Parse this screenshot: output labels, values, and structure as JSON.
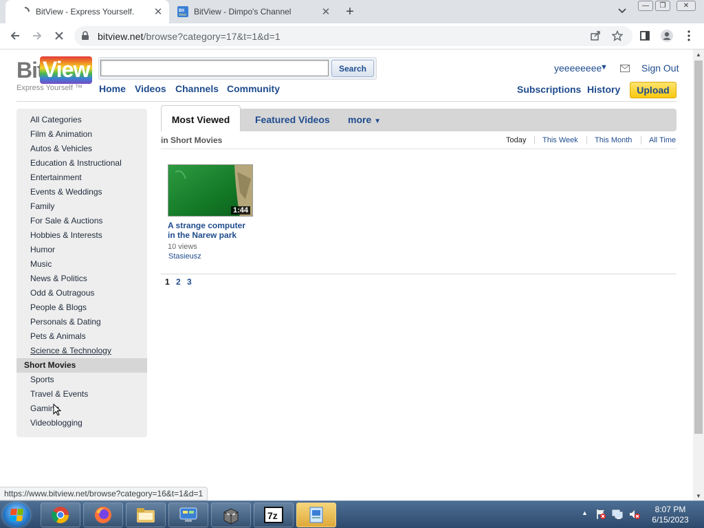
{
  "browser": {
    "tabs": [
      {
        "title": "BitView - Express Yourself.",
        "active": true
      },
      {
        "title": "BitView - Dimpo's Channel",
        "active": false
      }
    ],
    "url_host": "bitview.net",
    "url_path": "/browse?category=17&t=1&d=1",
    "status_url": "https://www.bitview.net/browse?category=16&t=1&d=1"
  },
  "site": {
    "logo_bit": "Bit",
    "logo_view": "View",
    "tagline": "Express Yourself ™",
    "search_value": "",
    "search_button": "Search",
    "nav": [
      "Home",
      "Videos",
      "Channels",
      "Community"
    ],
    "username": "yeeeeeeee",
    "sign_out": "Sign Out",
    "subscriptions": "Subscriptions",
    "history": "History",
    "upload": "Upload"
  },
  "sidebar": {
    "categories": [
      "All Categories",
      "Film & Animation",
      "Autos & Vehicles",
      "Education & Instructional",
      "Entertainment",
      "Events & Weddings",
      "Family",
      "For Sale & Auctions",
      "Hobbies & Interests",
      "Humor",
      "Music",
      "News & Politics",
      "Odd & Outragous",
      "People & Blogs",
      "Personals & Dating",
      "Pets & Animals",
      "Science & Technology",
      "Short Movies",
      "Sports",
      "Travel & Events",
      "Gaming",
      "Videoblogging"
    ],
    "selected": "Short Movies",
    "hovered": "Science & Technology"
  },
  "main": {
    "tabs": {
      "most_viewed": "Most Viewed",
      "featured": "Featured Videos",
      "more": "more"
    },
    "in_label": "in Short Movies",
    "time_filters": [
      "Today",
      "This Week",
      "This Month",
      "All Time"
    ],
    "current_filter": "Today",
    "videos": [
      {
        "title": "A strange computer in the Narew park",
        "duration": "1:44",
        "views": "10 views",
        "user": "Stasieusz"
      }
    ],
    "pages": [
      "1",
      "2",
      "3"
    ],
    "current_page": "1"
  },
  "taskbar": {
    "time": "8:07 PM",
    "date": "6/15/2023",
    "apps": [
      "chrome-icon",
      "firefox-icon",
      "explorer-icon",
      "control-panel-icon",
      "sandbox-icon",
      "7zip-icon",
      "app-icon"
    ]
  }
}
